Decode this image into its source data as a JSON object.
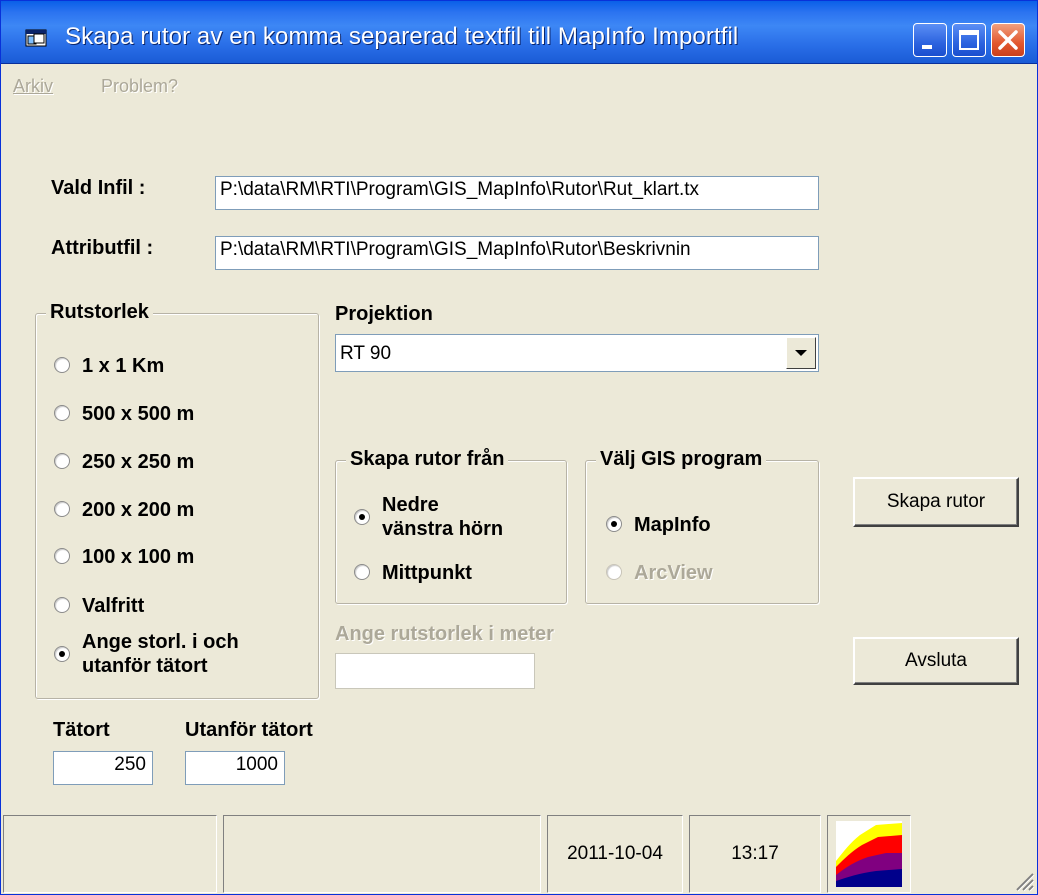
{
  "window": {
    "title": "Skapa rutor av en komma separerad textfil till MapInfo Importfil"
  },
  "menu": {
    "items": [
      {
        "label": "Arkiv"
      },
      {
        "label": "Problem?"
      }
    ]
  },
  "infile": {
    "label": "Vald Infil :",
    "value": "P:\\data\\RM\\RTI\\Program\\GIS_MapInfo\\Rutor\\Rut_klart.tx"
  },
  "attribfile": {
    "label": "Attributfil :",
    "value": "P:\\data\\RM\\RTI\\Program\\GIS_MapInfo\\Rutor\\Beskrivnin"
  },
  "rutstorlek": {
    "title": "Rutstorlek",
    "options": [
      {
        "label": "1 x 1 Km",
        "checked": false
      },
      {
        "label": "500 x 500 m",
        "checked": false
      },
      {
        "label": "250 x 250 m",
        "checked": false
      },
      {
        "label": "200 x 200 m",
        "checked": false
      },
      {
        "label": "100 x 100 m",
        "checked": false
      },
      {
        "label": "Valfritt",
        "checked": false
      },
      {
        "label": "Ange storl. i och",
        "label2": "utanför tätort",
        "checked": true
      }
    ]
  },
  "projektion": {
    "label": "Projektion",
    "selected": "RT 90"
  },
  "skapa_from": {
    "title": "Skapa rutor från",
    "options": [
      {
        "label": "Nedre",
        "label2": "vänstra hörn",
        "checked": true
      },
      {
        "label": "Mittpunkt",
        "checked": false
      }
    ]
  },
  "gis_program": {
    "title": "Välj GIS program",
    "options": [
      {
        "label": "MapInfo",
        "checked": true,
        "disabled": false
      },
      {
        "label": "ArcView",
        "checked": false,
        "disabled": true
      }
    ]
  },
  "rutstorlek_meter": {
    "label": "Ange rutstorlek i meter",
    "value": ""
  },
  "tatort": {
    "label": "Tätort",
    "value": "250"
  },
  "utanfor": {
    "label": "Utanför tätort",
    "value": "1000"
  },
  "buttons": {
    "skapa": "Skapa rutor",
    "avsluta": "Avsluta"
  },
  "status": {
    "date": "2011-10-04",
    "time": "13:17"
  },
  "colors": {
    "titlebar": "#2b71e9",
    "face": "#ece9d8",
    "disabled_text": "#aca899"
  }
}
